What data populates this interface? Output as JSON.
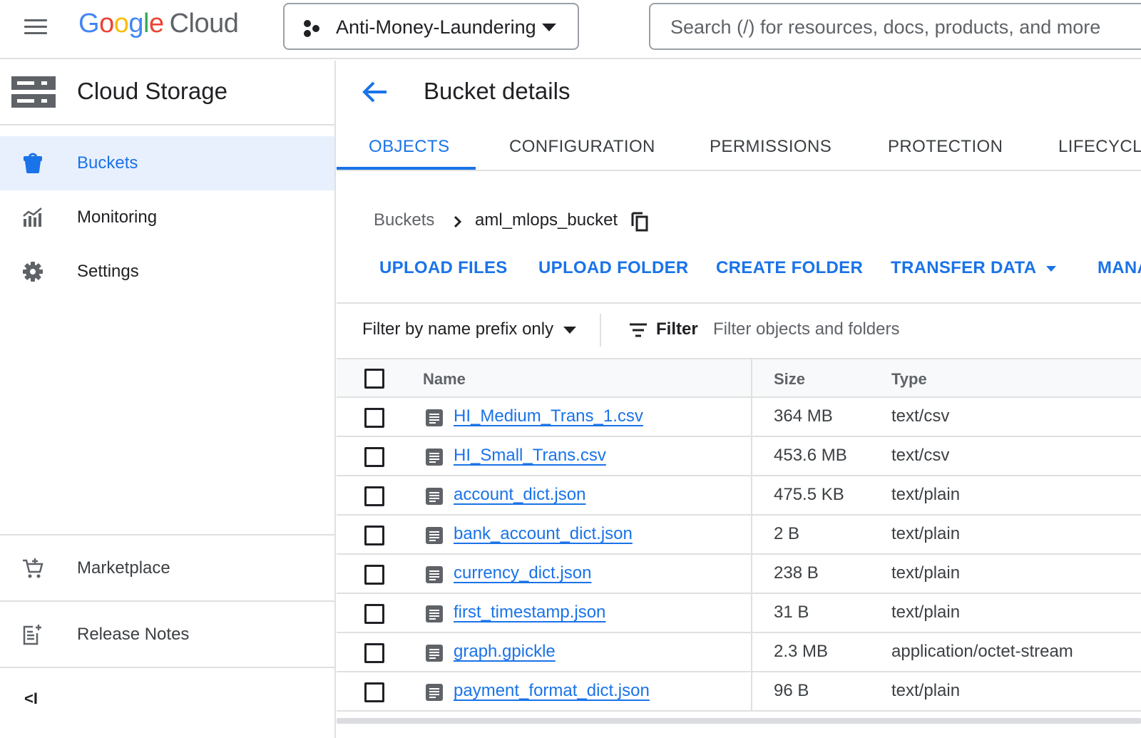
{
  "header": {
    "logo_parts": [
      "G",
      "o",
      "o",
      "g",
      "l",
      "e"
    ],
    "logo_suffix": "Cloud",
    "project_name": "Anti-Money-Laundering",
    "search_placeholder": "Search (/) for resources, docs, products, and more"
  },
  "sidebar": {
    "product_title": "Cloud Storage",
    "items": [
      {
        "label": "Buckets",
        "icon": "bucket-icon",
        "active": true
      },
      {
        "label": "Monitoring",
        "icon": "monitoring-icon",
        "active": false
      },
      {
        "label": "Settings",
        "icon": "gear-icon",
        "active": false
      }
    ],
    "bottom_items": [
      {
        "label": "Marketplace",
        "icon": "cart-icon"
      },
      {
        "label": "Release Notes",
        "icon": "release-notes-icon"
      }
    ],
    "collapse_label": "<I"
  },
  "main": {
    "title": "Bucket details",
    "tabs": [
      "OBJECTS",
      "CONFIGURATION",
      "PERMISSIONS",
      "PROTECTION",
      "LIFECYCLE"
    ],
    "active_tab": "OBJECTS",
    "breadcrumb": {
      "root": "Buckets",
      "current": "aml_mlops_bucket"
    },
    "actions": {
      "upload_files": "UPLOAD FILES",
      "upload_folder": "UPLOAD FOLDER",
      "create_folder": "CREATE FOLDER",
      "transfer_data": "TRANSFER DATA",
      "manage_holds": "MANAGE HOLDS"
    },
    "filter": {
      "prefix_option": "Filter by name prefix only",
      "filter_label": "Filter",
      "placeholder": "Filter objects and folders"
    },
    "table": {
      "columns": {
        "name": "Name",
        "size": "Size",
        "type": "Type"
      },
      "rows": [
        {
          "name": "HI_Medium_Trans_1.csv",
          "size": "364 MB",
          "type": "text/csv"
        },
        {
          "name": "HI_Small_Trans.csv",
          "size": "453.6 MB",
          "type": "text/csv"
        },
        {
          "name": "account_dict.json",
          "size": "475.5 KB",
          "type": "text/plain"
        },
        {
          "name": "bank_account_dict.json",
          "size": "2 B",
          "type": "text/plain"
        },
        {
          "name": "currency_dict.json",
          "size": "238 B",
          "type": "text/plain"
        },
        {
          "name": "first_timestamp.json",
          "size": "31 B",
          "type": "text/plain"
        },
        {
          "name": "graph.gpickle",
          "size": "2.3 MB",
          "type": "application/octet-stream"
        },
        {
          "name": "payment_format_dict.json",
          "size": "96 B",
          "type": "text/plain"
        }
      ]
    }
  },
  "colors": {
    "accent": "#1a73e8",
    "active_nav_bg": "#e8f0fe",
    "border": "#e0e0e0",
    "text_secondary": "#5f6368"
  }
}
